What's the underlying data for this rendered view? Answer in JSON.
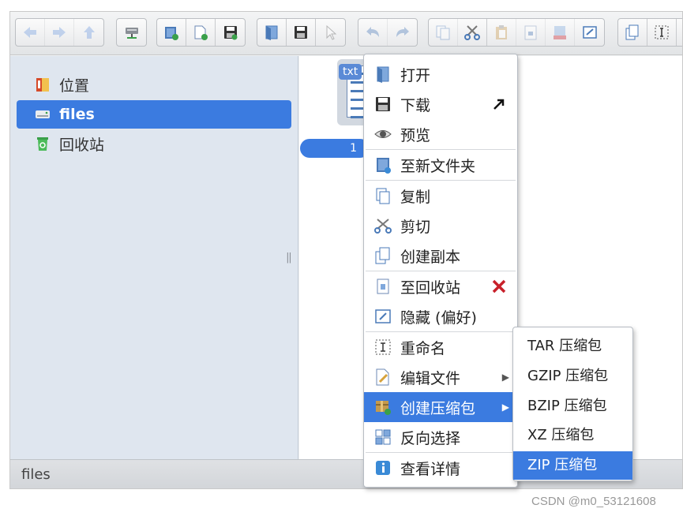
{
  "toolbar": {
    "groups": [
      [
        "back-icon",
        "forward-icon",
        "up-icon"
      ],
      [
        "network-drive-icon"
      ],
      [
        "new-folder-icon",
        "new-file-icon",
        "save-icon"
      ],
      [
        "open-icon",
        "download-icon",
        "select-cursor-icon"
      ],
      [
        "undo-icon",
        "redo-icon"
      ],
      [
        "copy-icon",
        "cut-icon",
        "paste-icon",
        "trash-icon",
        "delete-icon",
        "hide-icon"
      ],
      [
        "duplicate-icon",
        "rename-icon"
      ]
    ]
  },
  "sidebar": {
    "items": [
      {
        "label": "位置",
        "icon": "places-icon"
      },
      {
        "label": "files",
        "icon": "drive-icon",
        "selected": true
      },
      {
        "label": "回收站",
        "icon": "trash-icon"
      }
    ]
  },
  "file": {
    "type_tag": "txt",
    "name": "1"
  },
  "statusbar": {
    "text": "files"
  },
  "context_menu": {
    "items": [
      {
        "label": "打开",
        "icon": "open-icon"
      },
      {
        "label": "下载",
        "icon": "download-icon"
      },
      {
        "label": "预览",
        "icon": "preview-eye-icon"
      },
      {
        "label": "至新文件夹",
        "icon": "to-new-folder-icon"
      },
      {
        "label": "复制",
        "icon": "copy-icon"
      },
      {
        "label": "剪切",
        "icon": "cut-icon"
      },
      {
        "label": "创建副本",
        "icon": "duplicate-icon"
      },
      {
        "label": "至回收站",
        "icon": "trash-icon"
      },
      {
        "label": "隐藏 (偏好)",
        "icon": "hide-icon"
      },
      {
        "label": "重命名",
        "icon": "rename-icon"
      },
      {
        "label": "编辑文件",
        "icon": "edit-file-icon"
      },
      {
        "label": "创建压缩包",
        "icon": "archive-icon",
        "highlighted": true
      },
      {
        "label": "反向选择",
        "icon": "invert-selection-icon"
      },
      {
        "label": "查看详情",
        "icon": "info-icon"
      }
    ]
  },
  "submenu": {
    "items": [
      {
        "label": "TAR 压缩包"
      },
      {
        "label": "GZIP 压缩包"
      },
      {
        "label": "BZIP 压缩包"
      },
      {
        "label": "XZ 压缩包"
      },
      {
        "label": "ZIP 压缩包",
        "highlighted": true
      }
    ]
  },
  "watermark": "CSDN @m0_53121608",
  "colors": {
    "accent": "#3b7be0",
    "sidebar_bg": "#dfe6ef",
    "delete_red": "#c8202a"
  }
}
